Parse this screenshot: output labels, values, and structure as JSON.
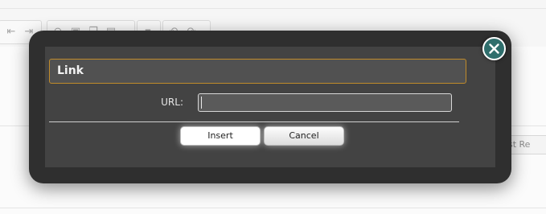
{
  "background": {
    "post_button_label": "Post Re"
  },
  "dialog": {
    "title": "Link",
    "url_label": "URL:",
    "url_value": "",
    "insert_label": "Insert",
    "cancel_label": "Cancel",
    "close_icon": "close-icon"
  },
  "colors": {
    "dialog_frame": "#2f2f2f",
    "dialog_panel": "#434343",
    "title_border": "#c08b2a",
    "close_button": "#2f6e6c"
  }
}
